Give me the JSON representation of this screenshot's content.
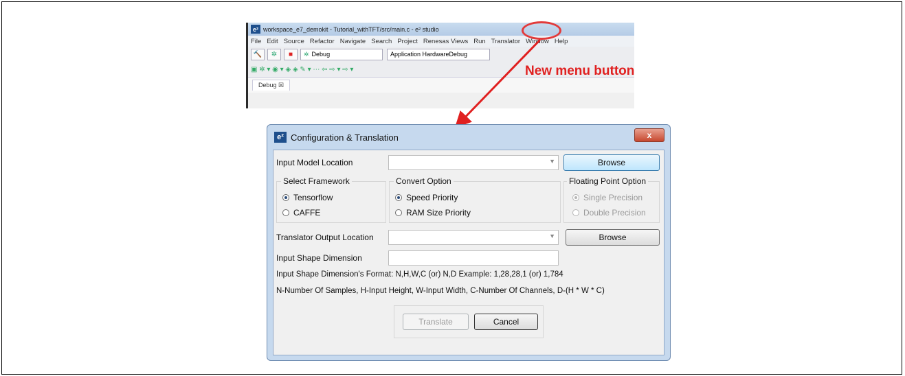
{
  "ide": {
    "title": "workspace_e7_demokit - Tutorial_withTFT/src/main.c - e² studio",
    "logo": "e²",
    "menu": [
      "File",
      "Edit",
      "Source",
      "Refactor",
      "Navigate",
      "Search",
      "Project",
      "Renesas Views",
      "Run",
      "Translator",
      "Window",
      "Help"
    ],
    "debug_combo": "Debug",
    "app_combo": "Application HardwareDebug",
    "tab_label": "Debug ☒"
  },
  "callout": {
    "text": "New menu button",
    "color": "#e02020"
  },
  "dialog": {
    "title": "Configuration & Translation",
    "logo": "e²",
    "close_label": "x",
    "input_model_label": "Input Model Location",
    "browse_label": "Browse",
    "framework_title": "Select Framework",
    "framework_options": [
      "Tensorflow",
      "CAFFE"
    ],
    "framework_selected": "Tensorflow",
    "convert_title": "Convert Option",
    "convert_options": [
      "Speed Priority",
      "RAM Size Priority"
    ],
    "convert_selected": "Speed Priority",
    "float_title": "Floating Point Option",
    "float_options": [
      "Single Precision",
      "Double Precision"
    ],
    "float_selected": "Single Precision",
    "output_label": "Translator Output Location",
    "browse2_label": "Browse",
    "shape_label": "Input Shape Dimension",
    "shape_value": "",
    "format_line": "Input Shape Dimension's Format: N,H,W,C (or) N,D    Example: 1,28,28,1 (or) 1,784",
    "legend_line": "N-Number Of Samples, H-Input Height, W-Input Width, C-Number Of Channels, D-(H * W * C)",
    "translate_label": "Translate",
    "cancel_label": "Cancel"
  }
}
